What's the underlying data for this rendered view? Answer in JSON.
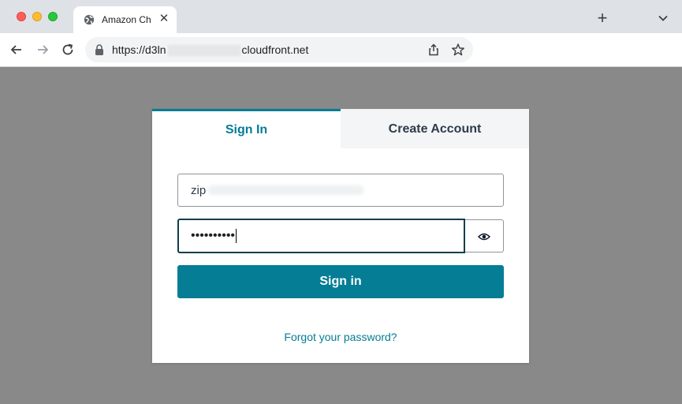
{
  "browser": {
    "tab_title": "Amazon Ch",
    "url_prefix": "https://d3ln",
    "url_suffix": "cloudfront.net",
    "new_tab_label": "+",
    "close_tab_label": "✕"
  },
  "auth": {
    "tabs": [
      {
        "label": "Sign In",
        "active": true
      },
      {
        "label": "Create Account",
        "active": false
      }
    ],
    "username_value": "zip",
    "password_value": "••••••••••",
    "submit_label": "Sign in",
    "forgot_link": "Forgot your password?"
  },
  "colors": {
    "accent": "#047d95",
    "page_overlay": "#898989",
    "tab_heading_inactive": "#2e3b4b"
  },
  "icons": [
    "globe-icon",
    "close-icon",
    "plus-icon",
    "chevron-down-icon",
    "back-arrow-icon",
    "forward-arrow-icon",
    "reload-icon",
    "lock-icon",
    "share-icon",
    "star-icon",
    "eye-icon"
  ]
}
